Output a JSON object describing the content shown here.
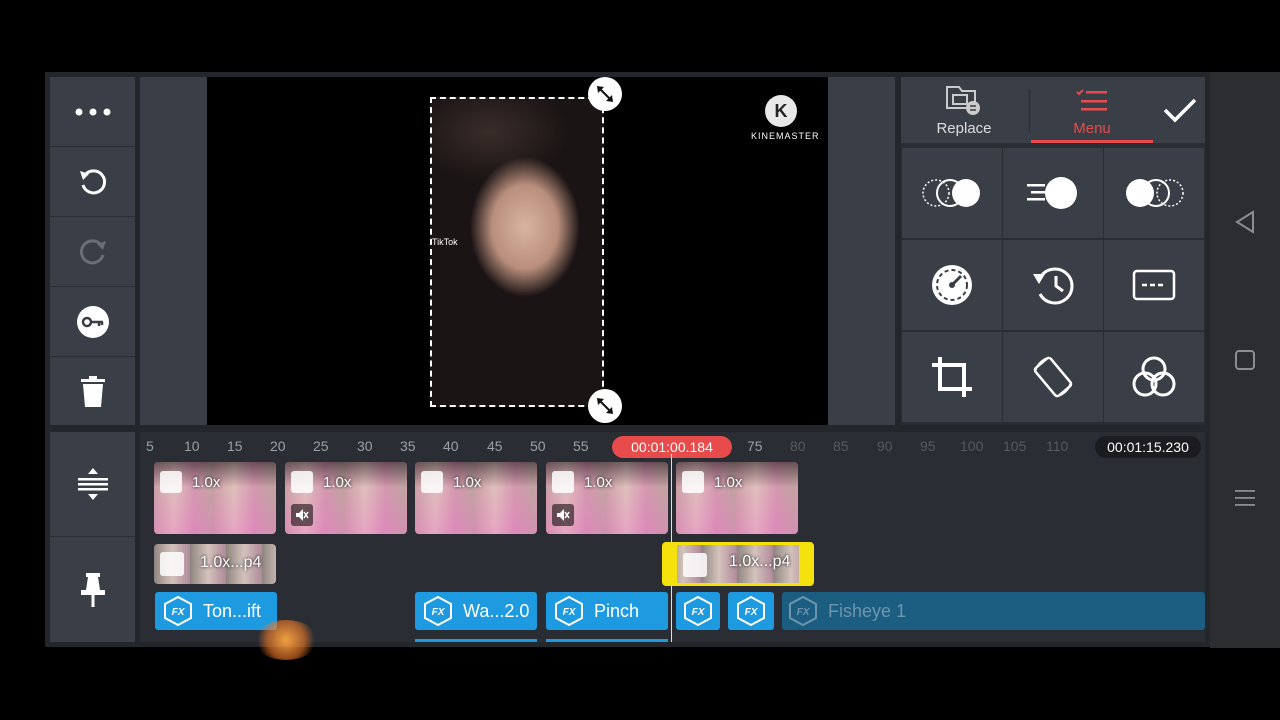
{
  "left_toolbar": {
    "more": "more-icon",
    "undo": "undo-icon",
    "redo": "redo-icon",
    "keyframe": "key-icon",
    "delete": "trash-icon",
    "split": "split-icon",
    "pin": "pin-icon"
  },
  "preview": {
    "watermark_brand": "KINEMASTER",
    "tiktok_label": "TikTok"
  },
  "right_panel": {
    "tabs": [
      {
        "label": "Replace",
        "icon": "replace-icon"
      },
      {
        "label": "Menu",
        "icon": "menu-list-icon"
      }
    ],
    "confirm_icon": "check-icon",
    "grid": [
      {
        "icon": "in-animation-icon"
      },
      {
        "icon": "motion-icon"
      },
      {
        "icon": "out-animation-icon"
      },
      {
        "icon": "speedometer-icon"
      },
      {
        "icon": "history-icon"
      },
      {
        "icon": "caption-icon"
      },
      {
        "icon": "crop-icon"
      },
      {
        "icon": "rotate-icon"
      },
      {
        "icon": "color-filter-icon"
      }
    ],
    "accent_color": "#e84b4b"
  },
  "timeline": {
    "ruler": [
      "5",
      "10",
      "15",
      "20",
      "25",
      "30",
      "35",
      "40",
      "45",
      "50",
      "55",
      "75",
      "80",
      "85",
      "90",
      "95",
      "100",
      "105",
      "110"
    ],
    "playhead_time": "00:01:00.184",
    "total_time": "00:01:15.230",
    "main_clips": [
      {
        "speed": "1.0x",
        "muted": false
      },
      {
        "speed": "1.0x",
        "muted": true
      },
      {
        "speed": "1.0x",
        "muted": false
      },
      {
        "speed": "1.0x",
        "muted": true
      },
      {
        "speed": "1.0x",
        "muted": false
      }
    ],
    "layer_clips": [
      {
        "label": "1.0x...p4",
        "selected": false
      },
      {
        "label": "1.0x...p4",
        "selected": true
      }
    ],
    "effects": [
      {
        "label": "Ton...ift"
      },
      {
        "label": "Wa...2.0"
      },
      {
        "label": "Pinch"
      },
      {
        "label": ""
      },
      {
        "label": ""
      },
      {
        "label": "Fisheye 1"
      }
    ],
    "selection_color": "#f5e20c",
    "effect_color": "#1e9be0"
  },
  "system_nav": {
    "back": "back-triangle-icon",
    "home": "home-square-icon",
    "menu": "menu-lines-icon"
  }
}
